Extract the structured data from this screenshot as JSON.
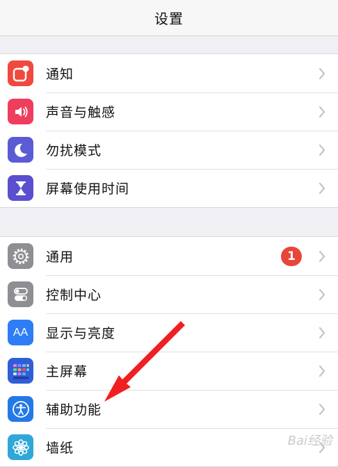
{
  "nav": {
    "title": "设置"
  },
  "groups": [
    {
      "items": [
        {
          "label": "通知",
          "icon": "notification-icon",
          "color": "#ef4a3d"
        },
        {
          "label": "声音与触感",
          "icon": "speaker-icon",
          "color": "#ee3d5d"
        },
        {
          "label": "勿扰模式",
          "icon": "moon-icon",
          "color": "#5b5bd6"
        },
        {
          "label": "屏幕使用时间",
          "icon": "hourglass-icon",
          "color": "#5b4fcf"
        }
      ]
    },
    {
      "items": [
        {
          "label": "通用",
          "icon": "gear-icon",
          "color": "#8e8e93",
          "badge": "1"
        },
        {
          "label": "控制中心",
          "icon": "toggles-icon",
          "color": "#8e8e93"
        },
        {
          "label": "显示与亮度",
          "icon": "text-size-icon",
          "color": "#2e7cf6",
          "icon_text": "AA"
        },
        {
          "label": "主屏幕",
          "icon": "home-screen-grid-icon",
          "color": "#2e5fd8"
        },
        {
          "label": "辅助功能",
          "icon": "accessibility-icon",
          "color": "#2479e6"
        },
        {
          "label": "墙纸",
          "icon": "flower-icon",
          "color": "#2fa7d9"
        }
      ]
    }
  ],
  "annotation": {
    "arrow_color": "#f02020"
  },
  "watermark": {
    "text": "Bai经验"
  }
}
